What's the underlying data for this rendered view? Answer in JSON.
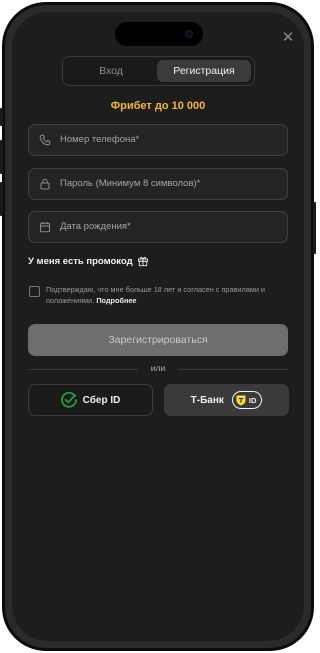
{
  "header": {
    "close_icon": "close-icon"
  },
  "tabs": [
    {
      "label": "Вход",
      "active": false
    },
    {
      "label": "Регистрация",
      "active": true
    }
  ],
  "bonus": {
    "text": "Фрибет до 10 000",
    "color": "#f5b730"
  },
  "form": {
    "phone": {
      "placeholder": "Номер телефона*",
      "icon": "phone-icon"
    },
    "password": {
      "placeholder": "Пароль (Минимум 8 символов)*",
      "icon": "lock-icon"
    },
    "birthdate": {
      "placeholder": "Дата рождения*",
      "icon": "calendar-icon"
    }
  },
  "promo": {
    "label": "У меня есть промокод",
    "icon": "gift-icon"
  },
  "agreement": {
    "checked": false,
    "text": "Подтверждаю, что мне больше 18 лет и согласен с правилами и положениями.",
    "link": "Подробнее"
  },
  "register_button": {
    "label": "Зарегистрироваться"
  },
  "divider": {
    "label": "или"
  },
  "sso": {
    "sber": {
      "label": "Сбер ID",
      "color": "#21a038"
    },
    "tbank": {
      "label": "Т-Банк",
      "badge": "ID",
      "color": "#ffdd2d"
    }
  }
}
